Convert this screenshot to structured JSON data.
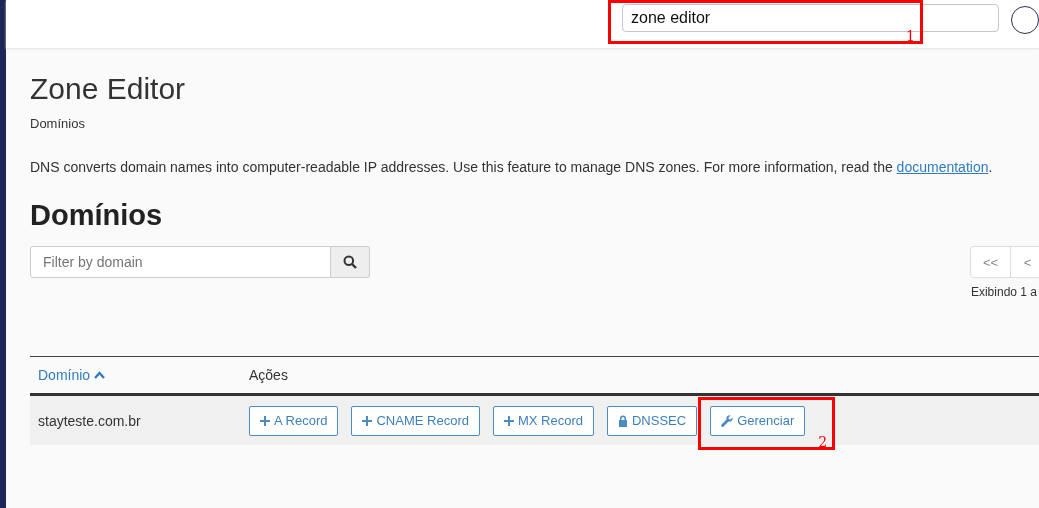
{
  "header": {
    "search": {
      "value": "zone editor"
    }
  },
  "page": {
    "title": "Zone Editor",
    "breadcrumb": "Domínios",
    "description": "DNS converts domain names into computer-readable IP addresses. Use this feature to manage DNS zones. For more information, read the ",
    "description_link": "documentation",
    "description_end": "."
  },
  "section": {
    "title": "Domínios",
    "filter": {
      "placeholder": "Filter by domain"
    },
    "pagination": {
      "buttons": [
        {
          "label": "<<"
        },
        {
          "label": "<"
        }
      ],
      "summary": "Exibindo 1 a"
    }
  },
  "table": {
    "columns": [
      {
        "label": "Domínio",
        "sorted": true
      },
      {
        "label": "Ações",
        "sorted": false
      }
    ],
    "rows": [
      {
        "domain": "stayteste.com.br",
        "actions": [
          {
            "label": "A Record",
            "kind": "plus"
          },
          {
            "label": "CNAME Record",
            "kind": "plus"
          },
          {
            "label": "MX Record",
            "kind": "plus"
          },
          {
            "label": "DNSSEC",
            "kind": "lock"
          },
          {
            "label": "Gerenciar",
            "kind": "wrench"
          }
        ]
      }
    ]
  },
  "annotations": [
    {
      "label": "1",
      "kind": "search"
    },
    {
      "label": "2",
      "kind": "manage"
    }
  ]
}
